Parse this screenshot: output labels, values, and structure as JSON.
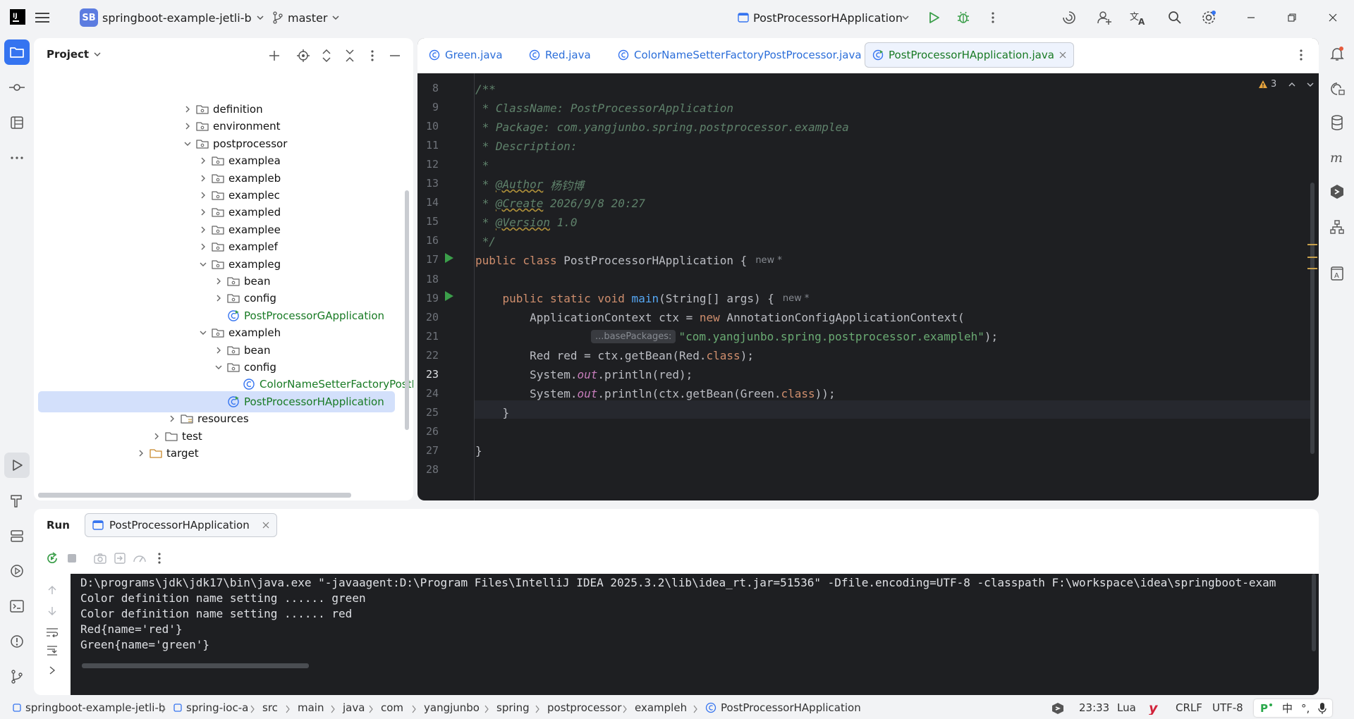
{
  "titlebar": {
    "project_badge": "SB",
    "project_name": "springboot-example-jetli-b",
    "branch": "master",
    "run_config": "PostProcessorHApplication"
  },
  "project_panel": {
    "title": "Project",
    "tree": [
      {
        "label": "definition",
        "type": "package",
        "depth": 2,
        "expanded": false
      },
      {
        "label": "environment",
        "type": "package",
        "depth": 2,
        "expanded": false
      },
      {
        "label": "postprocessor",
        "type": "package",
        "depth": 2,
        "expanded": true
      },
      {
        "label": "examplea",
        "type": "package",
        "depth": 3,
        "expanded": false
      },
      {
        "label": "exampleb",
        "type": "package",
        "depth": 3,
        "expanded": false
      },
      {
        "label": "examplec",
        "type": "package",
        "depth": 3,
        "expanded": false
      },
      {
        "label": "exampled",
        "type": "package",
        "depth": 3,
        "expanded": false
      },
      {
        "label": "examplee",
        "type": "package",
        "depth": 3,
        "expanded": false
      },
      {
        "label": "examplef",
        "type": "package",
        "depth": 3,
        "expanded": false
      },
      {
        "label": "exampleg",
        "type": "package",
        "depth": 3,
        "expanded": true
      },
      {
        "label": "bean",
        "type": "package",
        "depth": 4,
        "expanded": false
      },
      {
        "label": "config",
        "type": "package",
        "depth": 4,
        "expanded": false
      },
      {
        "label": "PostProcessorGApplication",
        "type": "class",
        "depth": 4
      },
      {
        "label": "exampleh",
        "type": "package",
        "depth": 3,
        "expanded": true
      },
      {
        "label": "bean",
        "type": "package",
        "depth": 4,
        "expanded": false
      },
      {
        "label": "config",
        "type": "package",
        "depth": 4,
        "expanded": true
      },
      {
        "label": "ColorNameSetterFactoryPostPro",
        "type": "class-green",
        "depth": 5
      },
      {
        "label": "PostProcessorHApplication",
        "type": "class",
        "depth": 4,
        "selected": true
      },
      {
        "label": "resources",
        "type": "folder-res",
        "depth": 1,
        "expanded": false
      },
      {
        "label": "test",
        "type": "folder",
        "depth": 0,
        "expanded": false
      },
      {
        "label": "target",
        "type": "folder-orange",
        "depth": -1,
        "expanded": false
      }
    ]
  },
  "editor": {
    "tabs": [
      {
        "label": "Green.java",
        "active": false
      },
      {
        "label": "Red.java",
        "active": false
      },
      {
        "label": "ColorNameSetterFactoryPostProcessor.java",
        "active": false
      },
      {
        "label": "PostProcessorHApplication.java",
        "active": true
      }
    ],
    "warnings": "3",
    "current_line": 23,
    "line_numbers": [
      "8",
      "9",
      "10",
      "11",
      "12",
      "13",
      "14",
      "15",
      "16",
      "17",
      "18",
      "19",
      "20",
      "21",
      "22",
      "23",
      "24",
      "25",
      "26",
      "27",
      "28"
    ],
    "code": {
      "l8": "/**",
      "l9": " * ClassName: PostProcessorApplication",
      "l10": " * Package: com.yangjunbo.spring.postprocessor.examplea",
      "l11": " * Description:",
      "l12": " *",
      "l13_pre": " * ",
      "l13_tag": "@Author",
      "l13_post": " 杨钧博",
      "l14_pre": " * ",
      "l14_tag": "@Create",
      "l14_post": " 2026/9/8 20:27",
      "l15_pre": " * ",
      "l15_tag": "@Version",
      "l15_post": " 1.0",
      "l16": " */",
      "l17_kw": "public class",
      "l17_name": " PostProcessorHApplication {",
      "l17_hint": "new *",
      "l19_kw": "    public static void",
      "l19_fn": " main",
      "l19_rest": "(String[] args) {",
      "l19_hint": "new *",
      "l20_pre": "        ApplicationContext ctx = ",
      "l20_kw": "new",
      "l20_post": " AnnotationConfigApplicationContext(",
      "l21_hint": "...basePackages:",
      "l21_str": "\"com.yangjunbo.spring.postprocessor.exampleh\"",
      "l21_post": ");",
      "l22_pre": "        Red red = ctx.getBean(Red.",
      "l22_kw": "class",
      "l22_post": ");",
      "l23_pre": "        System.",
      "l23_it": "out",
      "l23_post": ".println(red);",
      "l24_pre": "        System.",
      "l24_it": "out",
      "l24_mid": ".println(ctx.getBean(Green.",
      "l24_kw": "class",
      "l24_post": "));",
      "l25": "    }",
      "l27": "}"
    }
  },
  "run": {
    "title": "Run",
    "tab_label": "PostProcessorHApplication",
    "console": [
      "D:\\programs\\jdk\\jdk17\\bin\\java.exe \"-javaagent:D:\\Program Files\\IntelliJ IDEA 2025.3.2\\lib\\idea_rt.jar=51536\" -Dfile.encoding=UTF-8 -classpath F:\\workspace\\idea\\springboot-exam",
      "Color definition name setting ...... green",
      "Color definition name setting ...... red",
      "Red{name='red'}",
      "Green{name='green'}"
    ]
  },
  "statusbar": {
    "breadcrumbs": [
      "springboot-example-jetli-b",
      "spring-ioc-a",
      "src",
      "main",
      "java",
      "com",
      "yangjunbo",
      "spring",
      "postprocessor",
      "exampleh",
      "PostProcessorHApplication"
    ],
    "position": "23:33",
    "language": "Lua",
    "line_sep": "CRLF",
    "encoding": "UTF-8",
    "ime_lang": "中",
    "ime_punct": "°,"
  },
  "colors": {
    "accent": "#3574f0",
    "editor_bg": "#1e1f22",
    "keyword": "#cf8e6d",
    "string": "#6aab73",
    "comment": "#5f826b",
    "class_green": "#187a24"
  }
}
